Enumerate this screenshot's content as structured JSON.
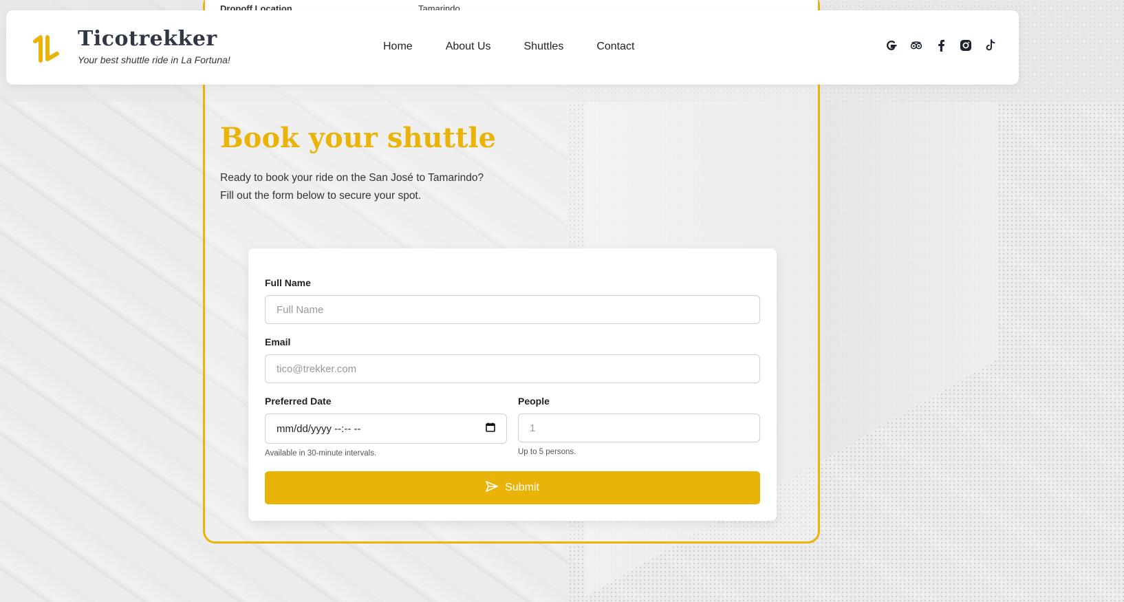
{
  "peek": {
    "label": "Dropoff Location",
    "value": "Tamarindo"
  },
  "brand": {
    "name": "Ticotrekker",
    "tagline": "Your best shuttle ride in La Fortuna!"
  },
  "nav": [
    {
      "label": "Home"
    },
    {
      "label": "About Us"
    },
    {
      "label": "Shuttles"
    },
    {
      "label": "Contact"
    }
  ],
  "socials": [
    "google-icon",
    "tripadvisor-icon",
    "facebook-icon",
    "instagram-icon",
    "tiktok-icon"
  ],
  "booking": {
    "title": "Book your shuttle",
    "lead1": "Ready to book your ride on the San José to Tamarindo?",
    "lead2": "Fill out the form below to secure your spot."
  },
  "form": {
    "name_label": "Full Name",
    "name_placeholder": "Full Name",
    "email_label": "Email",
    "email_placeholder": "tico@trekker.com",
    "date_label": "Preferred Date",
    "date_value": "mm/dd/yyyy --:-- --",
    "date_hint": "Available in 30-minute intervals.",
    "people_label": "People",
    "people_placeholder": "1",
    "people_hint": "Up to 5 persons.",
    "submit_label": "Submit"
  },
  "colors": {
    "accent": "#eab308",
    "text_dark": "#2f3745"
  }
}
